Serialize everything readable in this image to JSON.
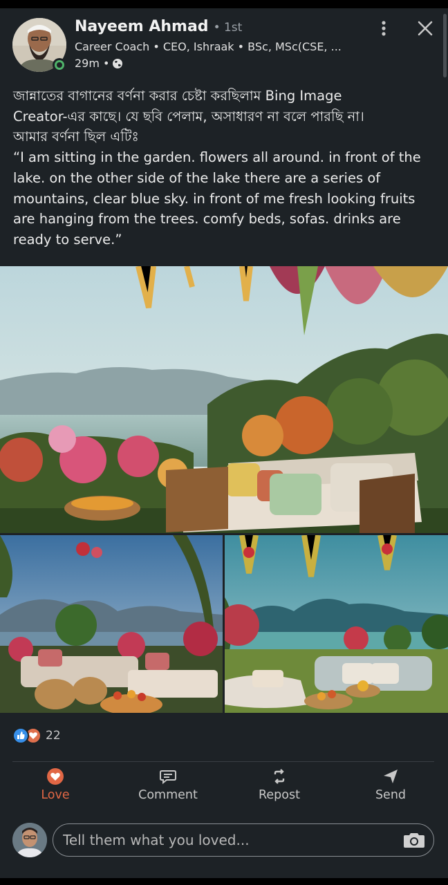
{
  "post": {
    "author": {
      "name": "Nayeem Ahmad",
      "degree": "• 1st",
      "headline": "Career Coach • CEO, Ishraak • BSc, MSc(CSE, ...",
      "time": "29m •",
      "visibility_icon": "globe-icon",
      "online": true
    },
    "text_lines": [
      "জান্নাতের বাগানের বর্ণনা করার চেষ্টা করছিলাম Bing Image",
      "Creator-এর কাছে। যে ছবি পেলাম, অসাধারণ না বলে পারছি না।",
      "আমার বর্ণনা ছিল এটিঃ",
      "“I am sitting in the garden. flowers all around. in front of the",
      "lake. on the other side of the lake there are a series of",
      "mountains, clear blue sky. in front of me fresh looking fruits",
      "are hanging from the trees. comfy beds, sofas. drinks are",
      "ready to serve.”"
    ],
    "images": [
      {
        "name": "garden-lake-sofa-image"
      },
      {
        "name": "garden-lounge-image-left"
      },
      {
        "name": "garden-lounge-image-right"
      }
    ],
    "reactions": {
      "icons": [
        "like-icon",
        "love-icon"
      ],
      "count": "22"
    }
  },
  "actions": [
    {
      "id": "love",
      "label": "Love",
      "icon": "heart-icon",
      "active": true
    },
    {
      "id": "comment",
      "label": "Comment",
      "icon": "comment-icon",
      "active": false
    },
    {
      "id": "repost",
      "label": "Repost",
      "icon": "repost-icon",
      "active": false
    },
    {
      "id": "send",
      "label": "Send",
      "icon": "send-icon",
      "active": false
    }
  ],
  "comment_box": {
    "placeholder": "Tell them what you loved..."
  },
  "colors": {
    "background": "#1d2226",
    "accent_love": "#e16745",
    "like_blue": "#378fe9",
    "online_green": "#4fb36a",
    "muted_text": "#c8c8c8"
  }
}
